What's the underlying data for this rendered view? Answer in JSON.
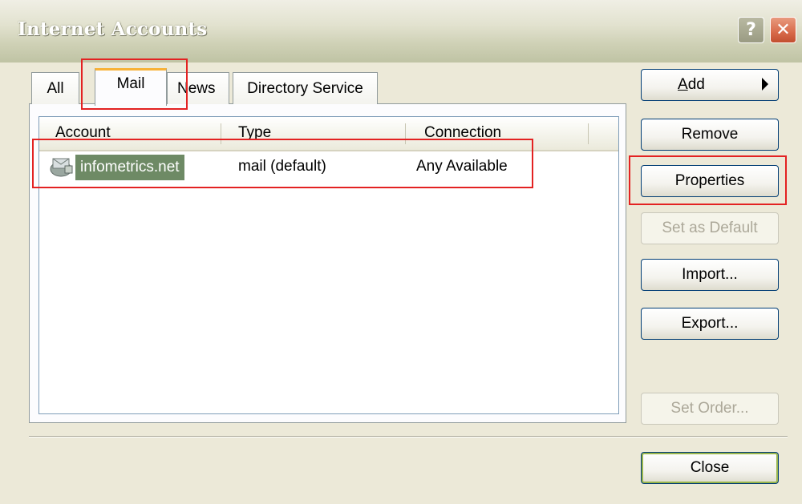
{
  "window": {
    "title": "Internet Accounts",
    "help_glyph": "?",
    "close_glyph": "✕"
  },
  "tabs": [
    {
      "label": "All",
      "selected": false
    },
    {
      "label": "Mail",
      "selected": true
    },
    {
      "label": "News",
      "selected": false
    },
    {
      "label": "Directory Service",
      "selected": false
    }
  ],
  "list": {
    "columns": [
      "Account",
      "Type",
      "Connection"
    ],
    "rows": [
      {
        "account": "infometrics.net",
        "type": "mail (default)",
        "connection": "Any Available",
        "selected": true,
        "icon": "mail-account-icon"
      }
    ]
  },
  "buttons": {
    "add": "Add",
    "remove": "Remove",
    "properties": "Properties",
    "set_default": "Set as Default",
    "import": "Import...",
    "export": "Export...",
    "set_order": "Set Order...",
    "close": "Close"
  },
  "colors": {
    "highlight": "#e32222",
    "selection": "#6e8a65",
    "tab_accent": "#f8b238"
  }
}
